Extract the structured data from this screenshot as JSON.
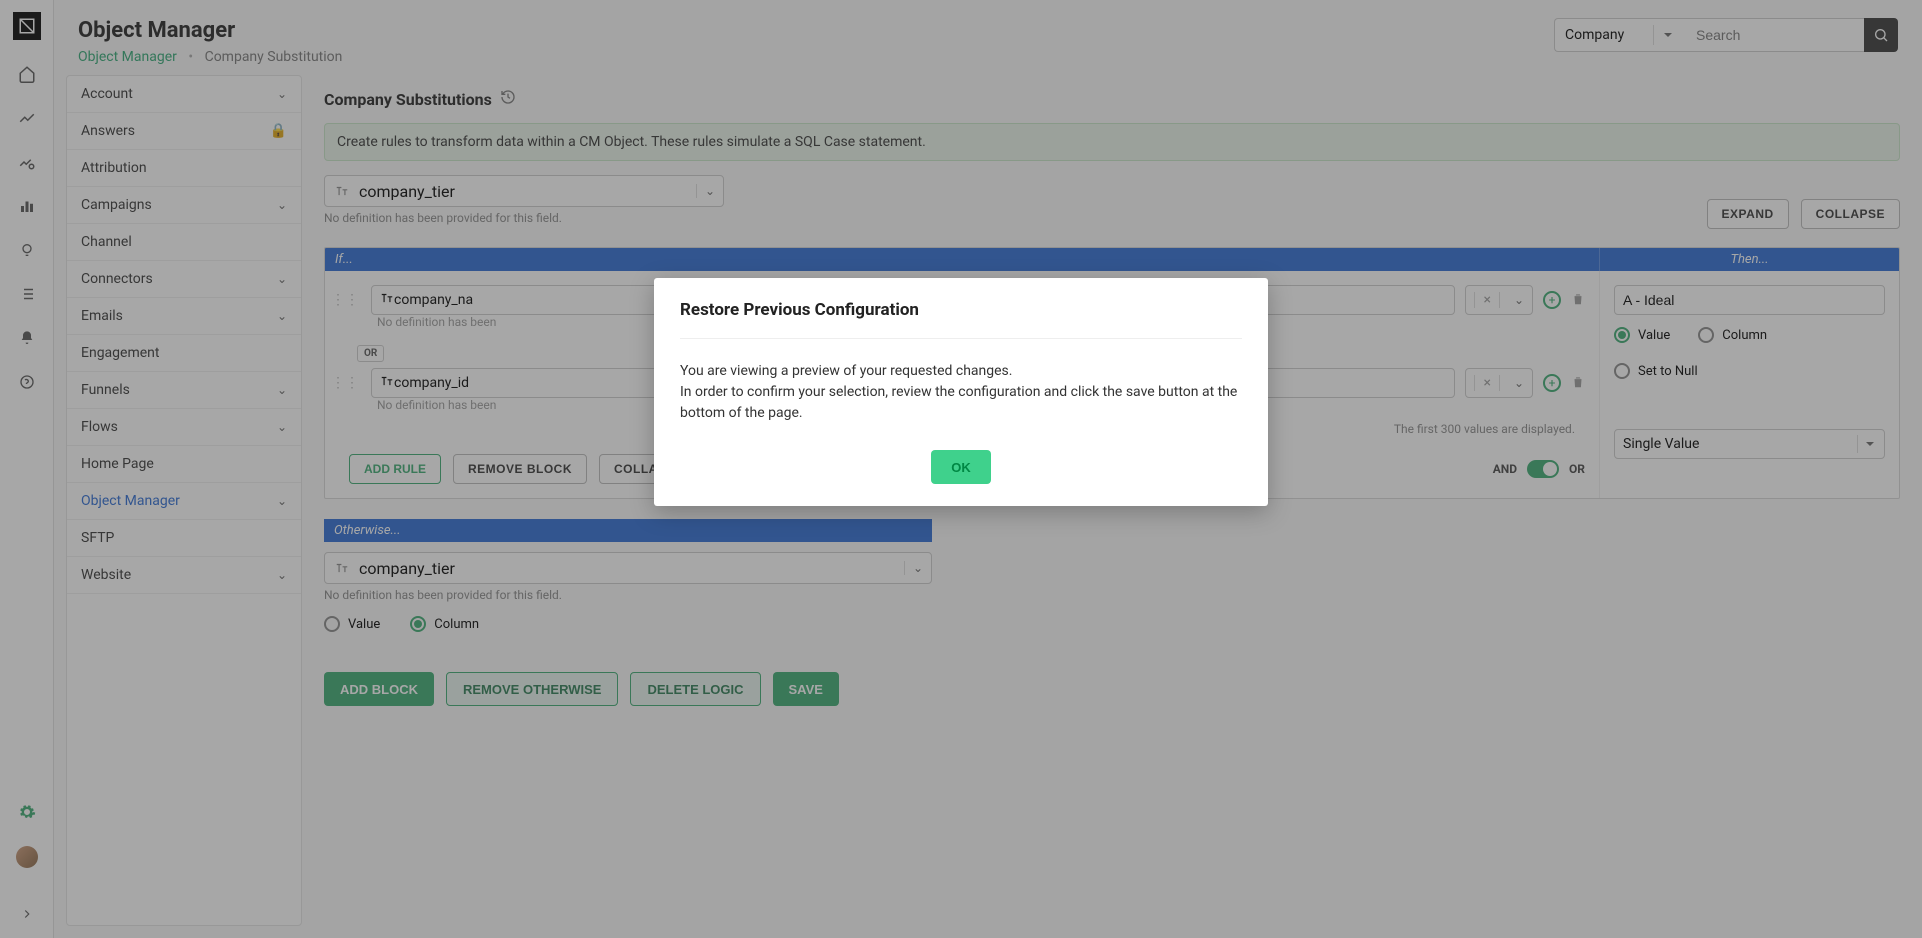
{
  "header": {
    "title": "Object Manager",
    "breadcrumb_link": "Object Manager",
    "breadcrumb_current": "Company Substitution",
    "search_scope": "Company",
    "search_placeholder": "Search"
  },
  "sidebar": {
    "items": [
      {
        "label": "Account",
        "expandable": true
      },
      {
        "label": "Answers",
        "locked": true
      },
      {
        "label": "Attribution"
      },
      {
        "label": "Campaigns",
        "expandable": true
      },
      {
        "label": "Channel"
      },
      {
        "label": "Connectors",
        "expandable": true
      },
      {
        "label": "Emails",
        "expandable": true
      },
      {
        "label": "Engagement"
      },
      {
        "label": "Funnels",
        "expandable": true
      },
      {
        "label": "Flows",
        "expandable": true
      },
      {
        "label": "Home Page"
      },
      {
        "label": "Object Manager",
        "expandable": true,
        "active": true
      },
      {
        "label": "SFTP"
      },
      {
        "label": "Website",
        "expandable": true
      }
    ]
  },
  "work": {
    "title": "Company Substitutions",
    "banner": "Create rules to transform data within a CM Object. These rules simulate a SQL Case statement.",
    "primary_field": "company_tier",
    "no_def_note": "No definition has been provided for this field.",
    "expand_btn": "EXPAND",
    "collapse_btn": "COLLAPSE",
    "if_label": "If...",
    "then_label": "Then...",
    "rule1_field": "company_na",
    "rule1_note": "No definition has been",
    "or_label": "OR",
    "rule2_field": "company_id",
    "rule2_note": "No definition has been",
    "first300": "The first 300 values are displayed.",
    "add_rule": "ADD RULE",
    "remove_block": "REMOVE BLOCK",
    "collapse_block": "COLLAPSE",
    "and_label": "AND",
    "or_toggle": "OR",
    "then_value": "A - Ideal",
    "radio_value": "Value",
    "radio_column": "Column",
    "radio_null": "Set to Null",
    "then_select": "Single Value",
    "otherwise_label": "Otherwise...",
    "otherwise_field": "company_tier",
    "otherwise_note": "No definition has been provided for this field.",
    "add_block": "ADD BLOCK",
    "remove_otherwise": "REMOVE OTHERWISE",
    "delete_logic": "DELETE LOGIC",
    "save": "SAVE"
  },
  "modal": {
    "title": "Restore Previous Configuration",
    "body_l1": "You are viewing a preview of your requested changes.",
    "body_l2": "In order to confirm your selection, review the configuration and click the save button at the bottom of the page.",
    "ok": "OK"
  }
}
